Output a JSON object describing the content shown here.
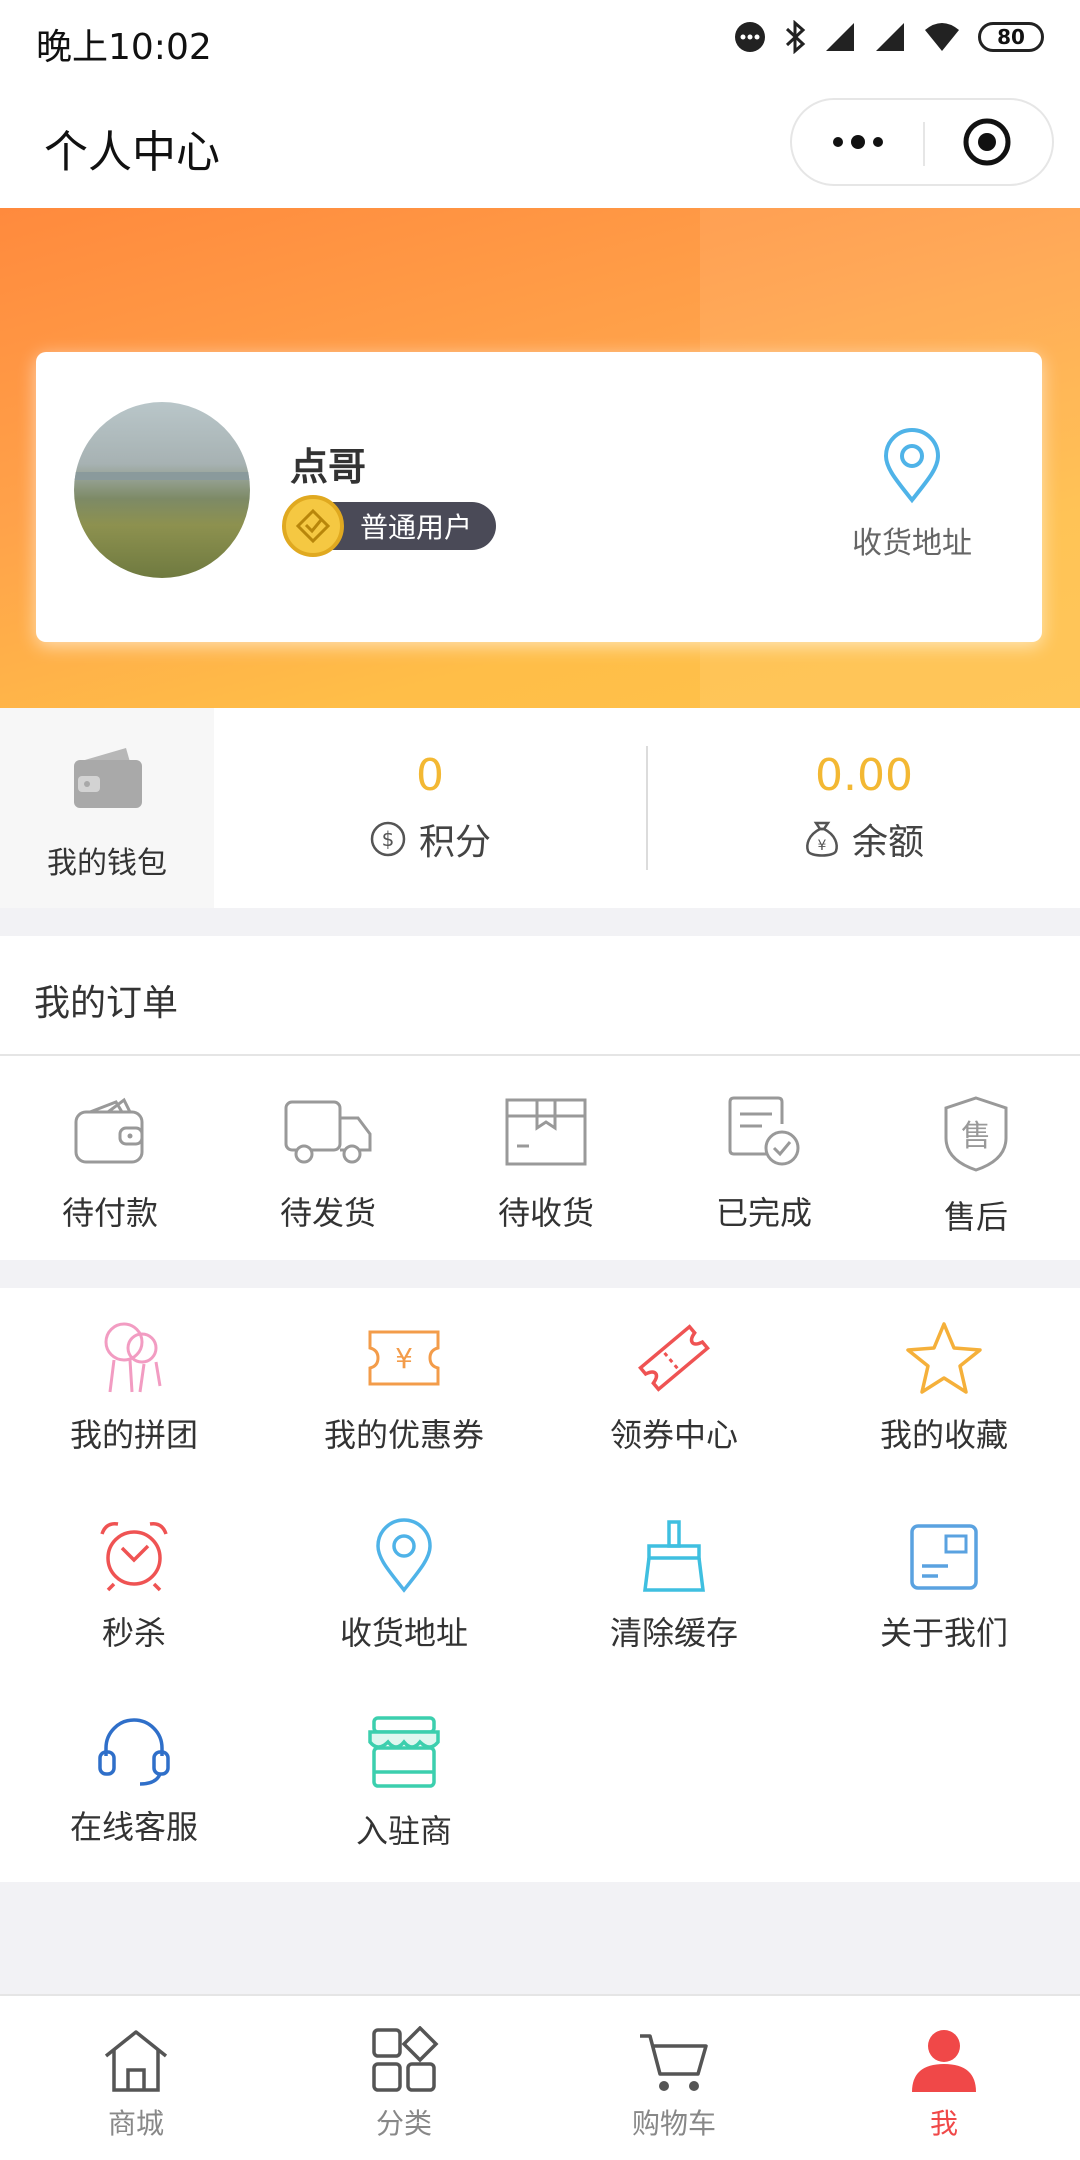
{
  "status_bar": {
    "time": "晚上10:02",
    "battery": "80"
  },
  "header": {
    "title": "个人中心"
  },
  "profile": {
    "username": "点哥",
    "member_level": "普通用户",
    "address_label": "收货地址"
  },
  "wallet": {
    "label": "我的钱包",
    "points_value": "0",
    "points_label": "积分",
    "balance_value": "0.00",
    "balance_label": "余额"
  },
  "orders": {
    "title": "我的订单",
    "items": [
      {
        "label": "待付款",
        "icon": "wallet-icon"
      },
      {
        "label": "待发货",
        "icon": "truck-icon"
      },
      {
        "label": "待收货",
        "icon": "package-icon"
      },
      {
        "label": "已完成",
        "icon": "completed-doc-icon"
      },
      {
        "label": "售后",
        "icon": "after-sales-shield-icon"
      }
    ]
  },
  "services": {
    "items": [
      {
        "label": "我的拼团",
        "icon": "group-buy-icon"
      },
      {
        "label": "我的优惠券",
        "icon": "coupon-icon"
      },
      {
        "label": "领券中心",
        "icon": "ticket-icon"
      },
      {
        "label": "我的收藏",
        "icon": "star-icon"
      },
      {
        "label": "秒杀",
        "icon": "alarm-clock-icon"
      },
      {
        "label": "收货地址",
        "icon": "location-pin-icon"
      },
      {
        "label": "清除缓存",
        "icon": "broom-icon"
      },
      {
        "label": "关于我们",
        "icon": "about-card-icon"
      },
      {
        "label": "在线客服",
        "icon": "headset-icon"
      },
      {
        "label": "入驻商",
        "icon": "store-icon"
      }
    ]
  },
  "tab_bar": {
    "items": [
      {
        "label": "商城",
        "icon": "home-icon"
      },
      {
        "label": "分类",
        "icon": "category-icon"
      },
      {
        "label": "购物车",
        "icon": "cart-icon"
      },
      {
        "label": "我",
        "icon": "user-icon"
      }
    ],
    "active": "我"
  },
  "colors": {
    "accent_orange": "#ff9a3d",
    "value_yellow": "#f3b833",
    "active_tab_red": "#f04848"
  }
}
